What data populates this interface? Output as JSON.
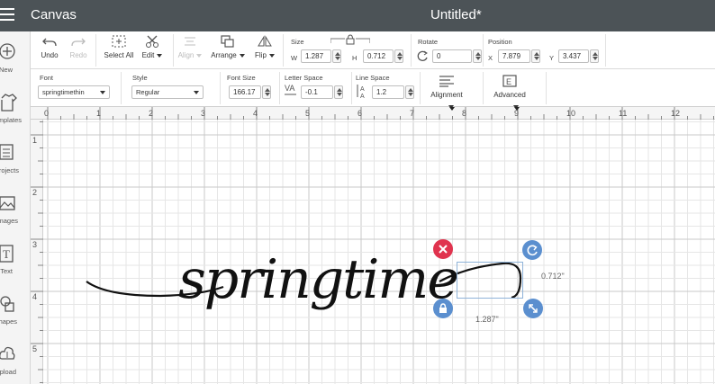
{
  "topbar": {
    "app_title": "Canvas",
    "doc_title": "Untitled*"
  },
  "sidebar": {
    "items": [
      {
        "label": "New",
        "icon": "plus-circle-icon"
      },
      {
        "label": "Templates",
        "icon": "shirt-icon"
      },
      {
        "label": "Projects",
        "icon": "projects-icon"
      },
      {
        "label": "Images",
        "icon": "image-icon"
      },
      {
        "label": "Text",
        "icon": "text-icon"
      },
      {
        "label": "Shapes",
        "icon": "shapes-icon"
      },
      {
        "label": "Upload",
        "icon": "cloud-upload-icon"
      }
    ]
  },
  "toolbar": {
    "undo": "Undo",
    "redo": "Redo",
    "select_all": "Select All",
    "edit": "Edit",
    "align": "Align",
    "arrange": "Arrange",
    "flip": "Flip",
    "size_label": "Size",
    "w_label": "W",
    "w_value": "1.287",
    "h_label": "H",
    "h_value": "0.712",
    "rotate_label": "Rotate",
    "rotate_value": "0",
    "position_label": "Position",
    "x_label": "X",
    "x_value": "7.879",
    "y_label": "Y",
    "y_value": "3.437"
  },
  "textbar": {
    "font_label": "Font",
    "font_value": "springtimethin",
    "style_label": "Style",
    "style_value": "Regular",
    "font_size_label": "Font Size",
    "font_size_value": "166.17",
    "letter_space_label": "Letter Space",
    "letter_space_value": "-0.1",
    "line_space_label": "Line Space",
    "line_space_value": "1.2",
    "alignment": "Alignment",
    "advanced": "Advanced"
  },
  "ruler": {
    "top": [
      "0",
      "1",
      "2",
      "3",
      "4",
      "5",
      "6",
      "7",
      "8",
      "9",
      "10",
      "11",
      "12"
    ],
    "left": [
      "1",
      "2",
      "3",
      "4",
      "5"
    ]
  },
  "canvas": {
    "text": "springtime",
    "width_label": "1.287\"",
    "height_label": "0.712\""
  },
  "colors": {
    "topbar": "#4c5357",
    "delete": "#e0334e",
    "handle": "#5b8fcf",
    "grid": "#e6e6e6",
    "grid_major": "#c9c9c9"
  }
}
